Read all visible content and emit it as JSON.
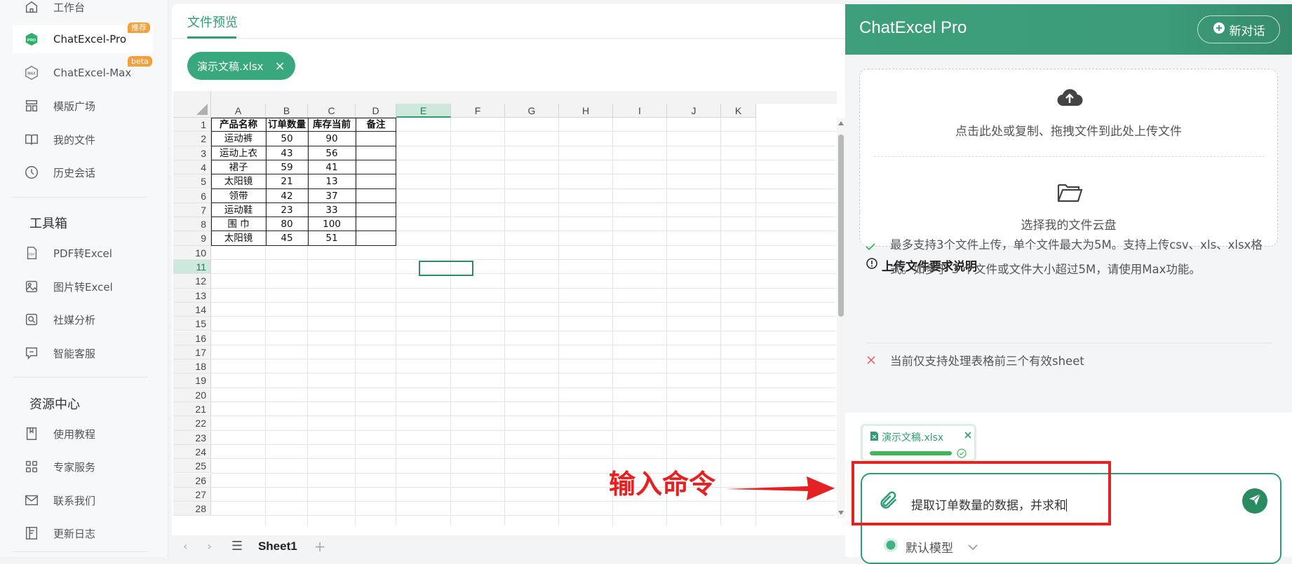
{
  "sidebar": {
    "items": [
      {
        "label": "工作台",
        "icon": "home-icon"
      },
      {
        "label": "ChatExcel-Pro",
        "icon": "pro-logo-icon",
        "badge": "推荐"
      },
      {
        "label": "ChatExcel-Max",
        "icon": "max-logo-icon",
        "badge": "beta"
      },
      {
        "label": "模版广场",
        "icon": "template-icon"
      },
      {
        "label": "我的文件",
        "icon": "book-icon"
      },
      {
        "label": "历史会话",
        "icon": "clock-icon"
      }
    ],
    "toolbox_title": "工具箱",
    "tools": [
      {
        "label": "PDF转Excel",
        "icon": "pdf-icon"
      },
      {
        "label": "图片转Excel",
        "icon": "image-icon"
      },
      {
        "label": "社媒分析",
        "icon": "search-icon"
      },
      {
        "label": "智能客服",
        "icon": "chat-icon"
      }
    ],
    "resources_title": "资源中心",
    "resources": [
      {
        "label": "使用教程",
        "icon": "bookmark-icon"
      },
      {
        "label": "专家服务",
        "icon": "grid-icon"
      },
      {
        "label": "联系我们",
        "icon": "mail-icon"
      },
      {
        "label": "更新日志",
        "icon": "log-icon"
      }
    ]
  },
  "preview": {
    "tab_label": "文件预览",
    "file_chip": "演示文稿.xlsx",
    "file_chip_close": "×",
    "columns": [
      "A",
      "B",
      "C",
      "D",
      "E",
      "F",
      "G",
      "H",
      "I",
      "J",
      "K"
    ],
    "rows": [
      "1",
      "2",
      "3",
      "4",
      "5",
      "6",
      "7",
      "8",
      "9",
      "10",
      "11",
      "12",
      "13",
      "14",
      "15",
      "16",
      "17",
      "18",
      "19",
      "20",
      "21",
      "22",
      "23",
      "24",
      "25",
      "26",
      "27",
      "28"
    ],
    "table_header": [
      "产品名称",
      "订单数量",
      "库存当前",
      "备注"
    ],
    "table_rows": [
      [
        "运动裤",
        "50",
        "90",
        ""
      ],
      [
        "运动上衣",
        "43",
        "56",
        ""
      ],
      [
        "裙子",
        "59",
        "41",
        ""
      ],
      [
        "太阳镜",
        "21",
        "13",
        ""
      ],
      [
        "领带",
        "42",
        "37",
        ""
      ],
      [
        "运动鞋",
        "23",
        "33",
        ""
      ],
      [
        "围 巾",
        "80",
        "100",
        ""
      ],
      [
        "太阳镜",
        "45",
        "51",
        ""
      ]
    ],
    "selected_cell": "E11",
    "sheet_tab": "Sheet1",
    "sheet_nav_prev": "‹",
    "sheet_nav_next": "›",
    "sheet_menu": "☰",
    "sheet_add": "+"
  },
  "annotation": {
    "text": "输入命令"
  },
  "chat": {
    "title": "ChatExcel Pro",
    "new_chat_label": "新对话",
    "upload_prompt": "点击此处或复制、拖拽文件到此处上传文件",
    "cloud_prompt": "选择我的文件云盘",
    "requirements_title": "上传文件要求说明",
    "requirement_1_line1": "最多支持3个文件上传，单个文件最大为5M。支持上传csv、xls、xlsx格",
    "requirement_1_line2": "式。如多于 3 个文件或文件大小超过5M，请使用Max功能。",
    "requirement_2": "当前仅支持处理表格前三个有效sheet",
    "attachment_name": "演示文稿.xlsx",
    "attachment_progress": 1.0,
    "input_text": "提取订单数量的数据，并求和",
    "model_label": "默认模型"
  },
  "colors": {
    "accent": "#2e9d76",
    "header_green": "#3d9f7b",
    "annotation_red": "#e52222",
    "badge_orange": "#f5a03a"
  }
}
